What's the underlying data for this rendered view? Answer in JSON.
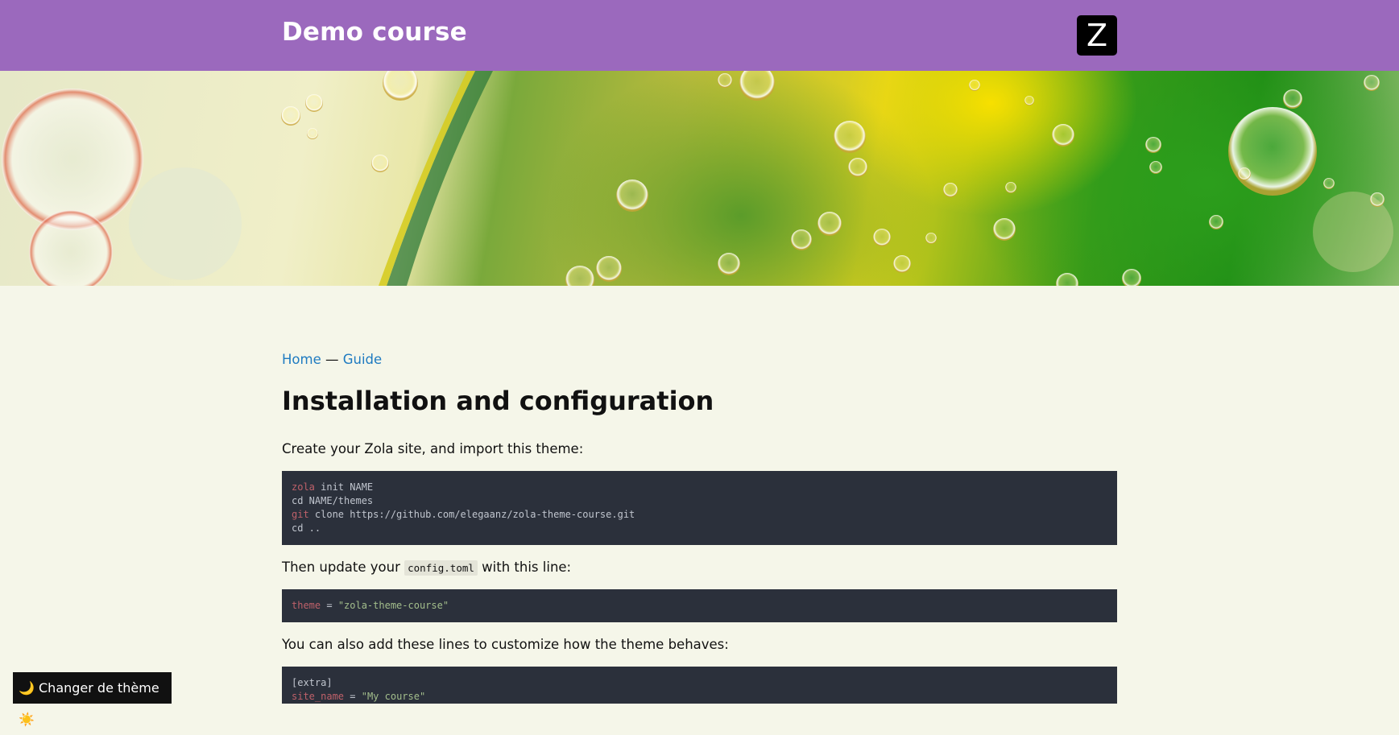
{
  "header": {
    "site_title": "Demo course",
    "logo_letter": "Z",
    "background": "#9b69bd"
  },
  "breadcrumb": {
    "home": "Home",
    "separator": "—",
    "guide": "Guide"
  },
  "page_title": "Installation and configuration",
  "intro_text": "Create your Zola site, and import this theme:",
  "code_install": [
    {
      "cmd": "zola",
      "rest": " init NAME"
    },
    {
      "cmd": "",
      "rest": "cd NAME/themes"
    },
    {
      "cmd": "git",
      "rest": " clone https://github.com/elegaanz/zola-theme-course.git"
    },
    {
      "cmd": "",
      "rest": "cd .."
    }
  ],
  "update_text": {
    "before": "Then update your ",
    "code": "config.toml",
    "after": " with this line:"
  },
  "code_theme": {
    "key": "theme",
    "eq": " = ",
    "value": "\"zola-theme-course\""
  },
  "customize_text": "You can also add these lines to customize how the theme behaves:",
  "code_extra": {
    "section": "[extra]",
    "key": "site_name",
    "eq": " = ",
    "value": "\"My course\""
  },
  "theme_toggle": {
    "label": "🌙 Changer de thème ☀️"
  },
  "colors": {
    "page_background": "#f5f6e9",
    "link": "#1f7bc1",
    "code_background": "#2b303b",
    "code_keyword": "#bf616a",
    "code_string": "#a3be8c"
  }
}
